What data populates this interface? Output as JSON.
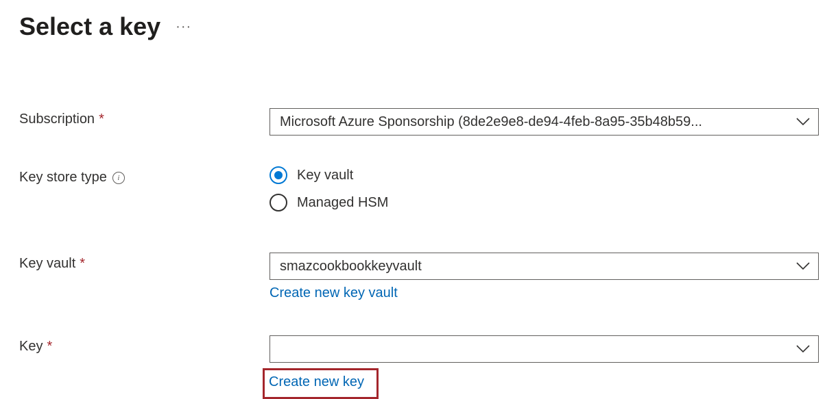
{
  "header": {
    "title": "Select a key",
    "ellipsis": "···"
  },
  "form": {
    "subscription": {
      "label": "Subscription",
      "value": "Microsoft Azure Sponsorship (8de2e9e8-de94-4feb-8a95-35b48b59..."
    },
    "keystore": {
      "label": "Key store type",
      "options": {
        "keyvault": "Key vault",
        "managedhsm": "Managed HSM"
      }
    },
    "keyvault": {
      "label": "Key vault",
      "value": "smazcookbookkeyvault",
      "create_link": "Create new key vault"
    },
    "key": {
      "label": "Key",
      "value": "",
      "create_link": "Create new key"
    }
  }
}
